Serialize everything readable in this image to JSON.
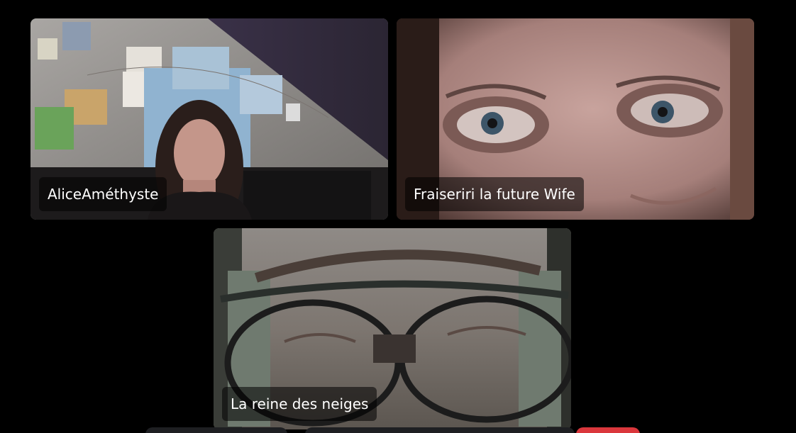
{
  "participants": [
    {
      "name": "AliceAméthyste"
    },
    {
      "name": "Fraiseriri la future Wife"
    },
    {
      "name": "La reine des neiges"
    }
  ],
  "colors": {
    "background": "#000000",
    "nameplate_bg": "rgba(0,0,0,0.55)",
    "leave_button": "#da373c",
    "control_bar": "#1e1f22"
  }
}
